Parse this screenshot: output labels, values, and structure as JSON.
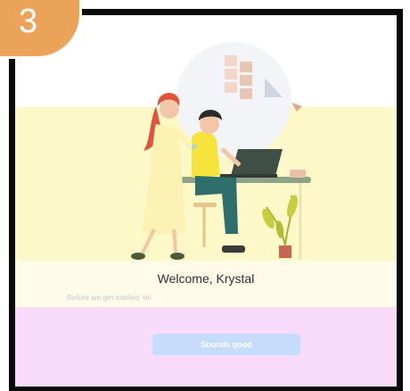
{
  "step_badge": {
    "number": "3",
    "color": "#eba35a"
  },
  "welcome": {
    "title": "Welcome, Krystal",
    "subtitle": "Before we get started, tel"
  },
  "primary_button": {
    "label": "Sounds good",
    "color": "#c6dcfb"
  },
  "colors": {
    "frame": "#0b0b0b",
    "band_yellow": "#fdf8c8",
    "band_cream": "#fffbe9",
    "band_pink": "#f8dbfb"
  },
  "icons": [
    "onboarding-illustration",
    "laptop-icon",
    "plant-icon"
  ]
}
